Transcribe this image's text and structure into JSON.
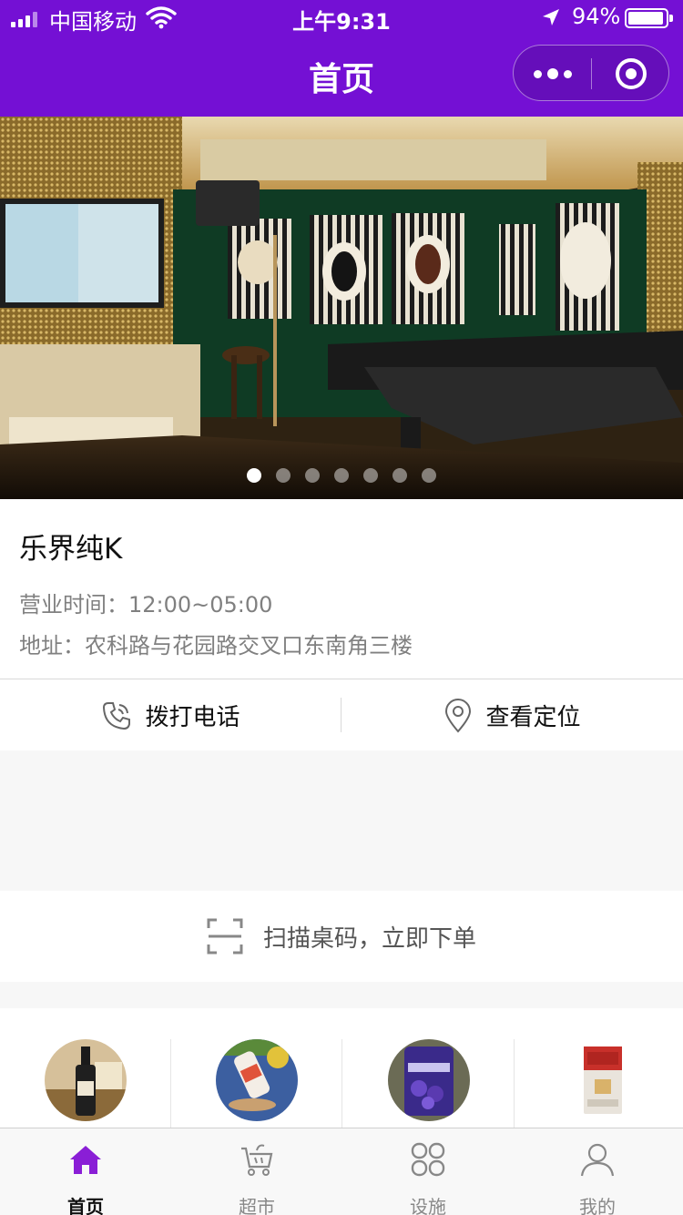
{
  "status_bar": {
    "carrier": "中国移动",
    "time": "上午9:31",
    "battery": "94%",
    "battery_level": 0.94
  },
  "nav": {
    "title": "首页",
    "more_icon": "more-dots-icon",
    "close_icon": "target-close-icon"
  },
  "banner": {
    "slide_count": 7,
    "active_slide": 1
  },
  "store": {
    "name": "乐界纯K",
    "hours": "营业时间：12:00~05:00",
    "address": "地址：农科路与花园路交叉口东南角三楼"
  },
  "actions": {
    "call": {
      "label": "拨打电话",
      "icon": "phone-icon"
    },
    "map": {
      "label": "查看定位",
      "icon": "location-pin-icon"
    }
  },
  "scan": {
    "label": "扫描桌码，立即下单",
    "icon": "scan-icon"
  },
  "categories": [
    {
      "thumb": "liquor-bottle-image"
    },
    {
      "thumb": "juice-snack-image"
    },
    {
      "thumb": "candy-bag-image"
    },
    {
      "thumb": "cigarette-pack-image"
    }
  ],
  "tabbar": {
    "accent_color": "#8a1ed6",
    "tabs": [
      {
        "label": "首页",
        "icon": "home-icon",
        "active": true
      },
      {
        "label": "超市",
        "icon": "cart-icon",
        "active": false
      },
      {
        "label": "设施",
        "icon": "grid-icon",
        "active": false
      },
      {
        "label": "我的",
        "icon": "user-icon",
        "active": false
      }
    ]
  },
  "colors": {
    "nav_bg": "#7410d4",
    "page_bg": "#f7f7f7"
  }
}
